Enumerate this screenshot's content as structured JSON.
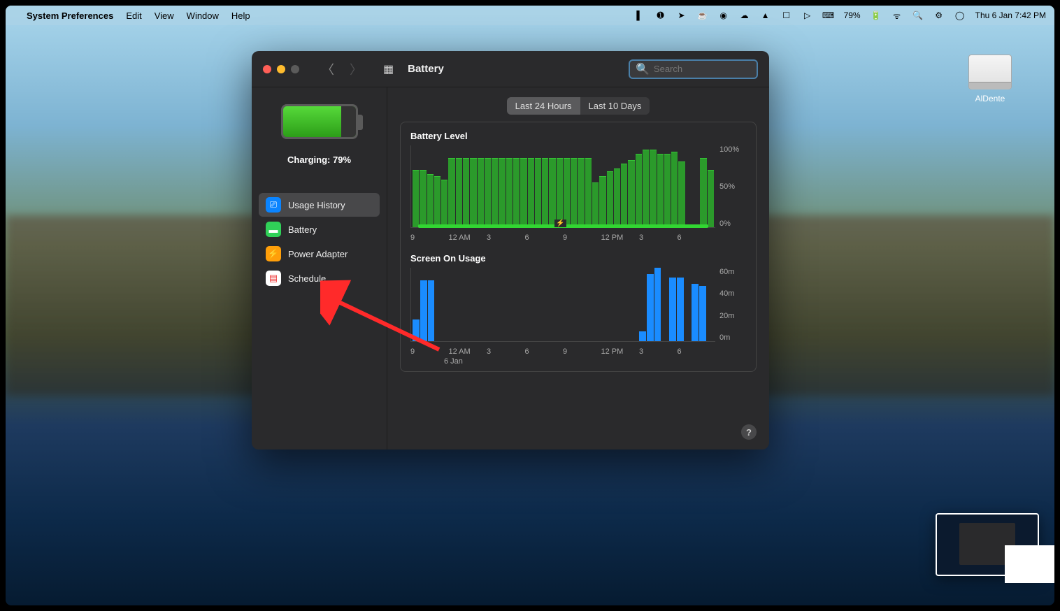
{
  "menubar": {
    "app_name": "System Preferences",
    "menus": [
      "Edit",
      "View",
      "Window",
      "Help"
    ],
    "battery_pct": "79%",
    "datetime": "Thu 6 Jan  7:42 PM"
  },
  "desktop_icon": {
    "label": "AlDente"
  },
  "window": {
    "title": "Battery",
    "search_placeholder": "Search"
  },
  "sidebar": {
    "charging_text": "Charging: 79%",
    "items": [
      {
        "label": "Usage History",
        "icon": "usage",
        "selected": true
      },
      {
        "label": "Battery",
        "icon": "batt",
        "selected": false
      },
      {
        "label": "Power Adapter",
        "icon": "pow",
        "selected": false
      },
      {
        "label": "Schedule",
        "icon": "sched",
        "selected": false
      }
    ]
  },
  "segmented": {
    "options": [
      "Last 24 Hours",
      "Last 10 Days"
    ],
    "active": 0
  },
  "chart_data": [
    {
      "type": "bar",
      "title": "Battery Level",
      "ylabel": "",
      "yticks": [
        "100%",
        "50%",
        "0%"
      ],
      "ylim": [
        0,
        100
      ],
      "xticks": [
        "9",
        "12 AM",
        "3",
        "6",
        "9",
        "12 PM",
        "3",
        "6"
      ],
      "values": [
        70,
        70,
        65,
        62,
        58,
        85,
        85,
        85,
        85,
        85,
        85,
        85,
        85,
        85,
        85,
        85,
        85,
        85,
        85,
        85,
        85,
        85,
        85,
        85,
        85,
        55,
        62,
        68,
        72,
        78,
        82,
        90,
        95,
        95,
        90,
        90,
        92,
        80,
        0,
        0,
        85,
        70
      ]
    },
    {
      "type": "bar",
      "title": "Screen On Usage",
      "ylabel": "",
      "yticks": [
        "60m",
        "40m",
        "20m",
        "0m"
      ],
      "ylim": [
        0,
        60
      ],
      "xticks": [
        "9",
        "12 AM",
        "3",
        "6",
        "9",
        "12 PM",
        "3",
        "6"
      ],
      "date_label": "6 Jan",
      "values": [
        18,
        50,
        50,
        0,
        0,
        0,
        0,
        0,
        0,
        0,
        0,
        0,
        0,
        0,
        0,
        0,
        0,
        0,
        0,
        0,
        0,
        0,
        0,
        0,
        0,
        0,
        0,
        0,
        0,
        0,
        8,
        55,
        60,
        0,
        52,
        52,
        0,
        47,
        45,
        0
      ]
    }
  ],
  "help": "?"
}
